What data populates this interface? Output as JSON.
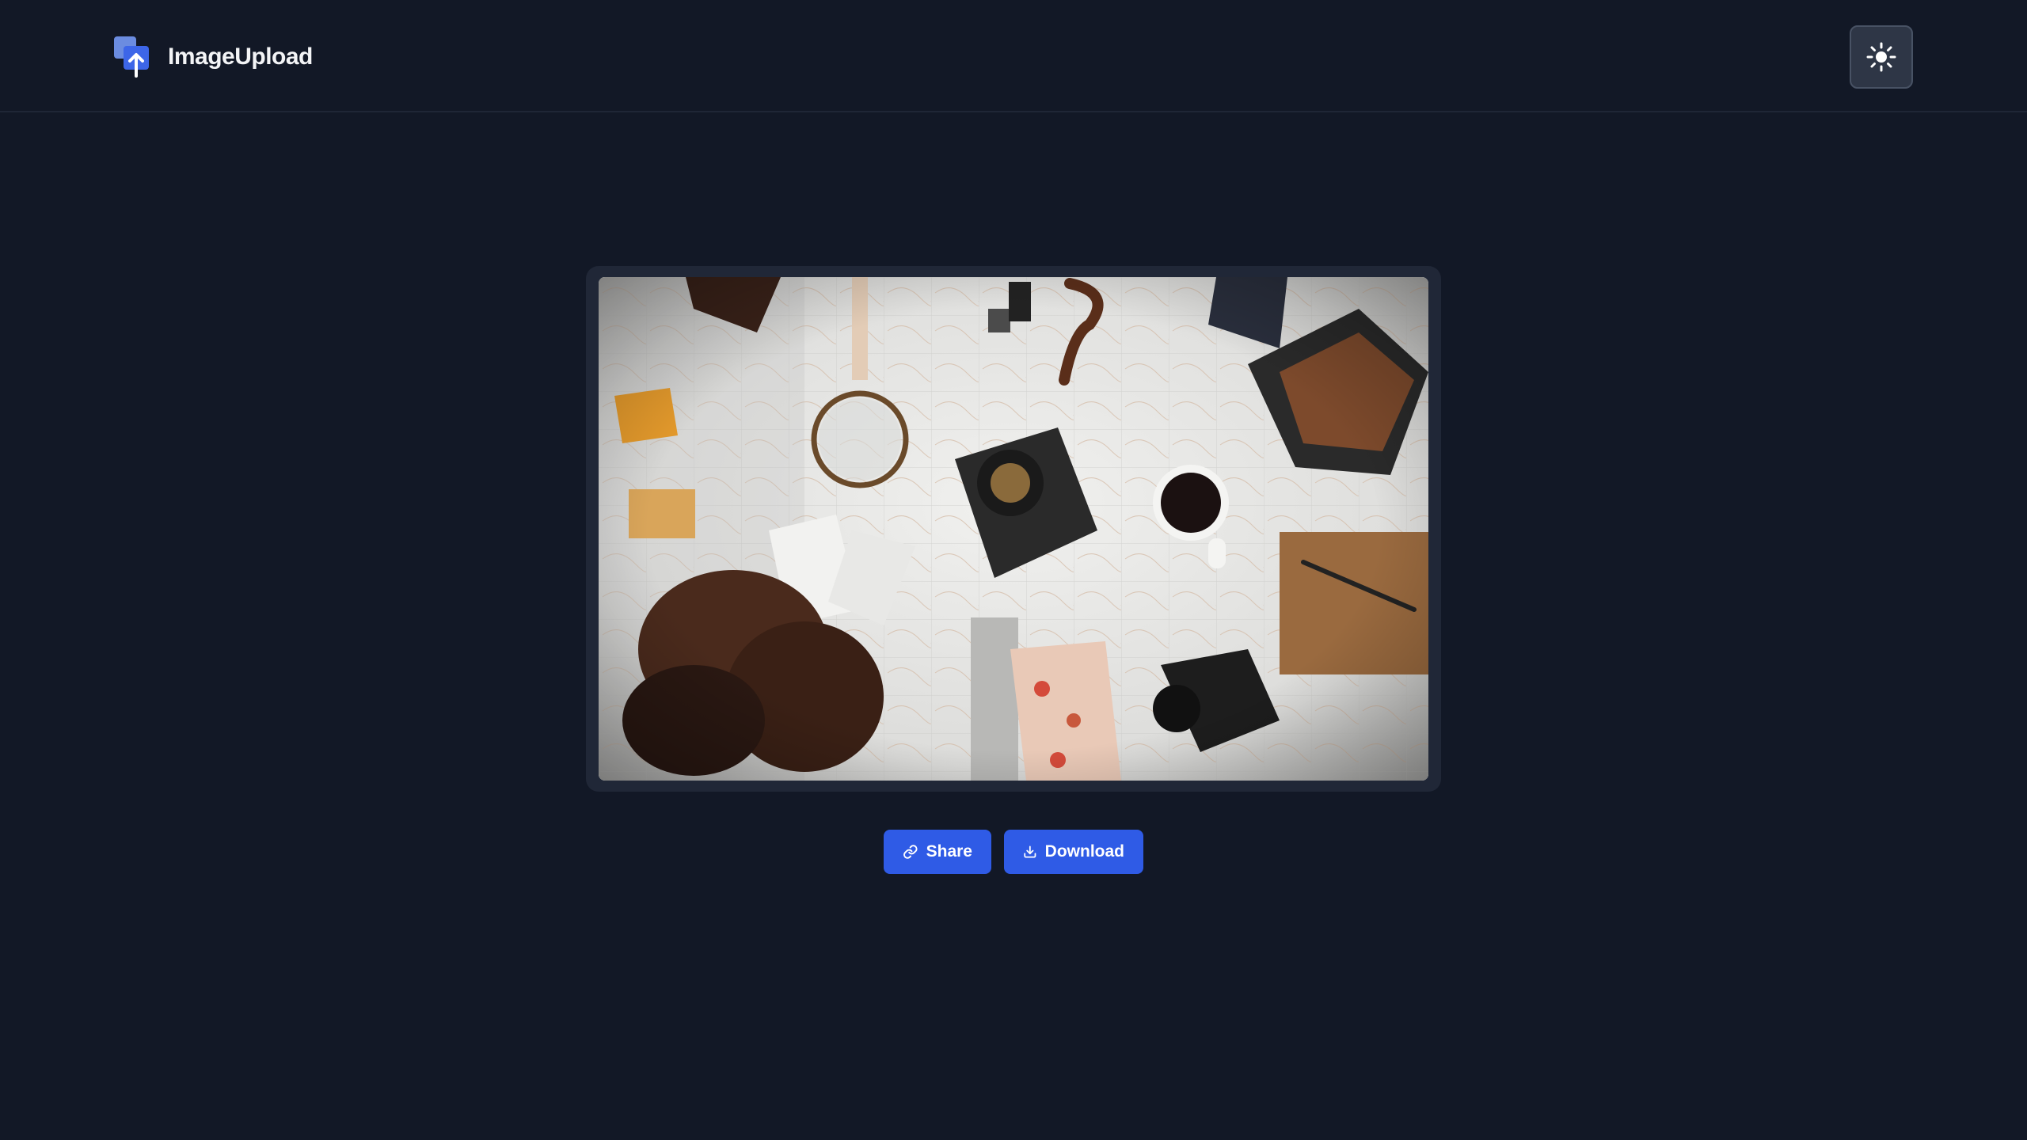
{
  "header": {
    "brand_name": "ImageUpload",
    "logo_icon": "image-upload-logo-icon",
    "theme_toggle_icon": "sun-icon"
  },
  "main": {
    "image": {
      "description_icon": "uploaded-photo"
    },
    "actions": {
      "share_label": "Share",
      "share_icon": "link-icon",
      "download_label": "Download",
      "download_icon": "download-icon"
    }
  },
  "colors": {
    "background": "#121826",
    "frame": "#202737",
    "accent": "#2f5be6",
    "toggle_bg": "#2e3646",
    "text": "#f3f4f6"
  }
}
